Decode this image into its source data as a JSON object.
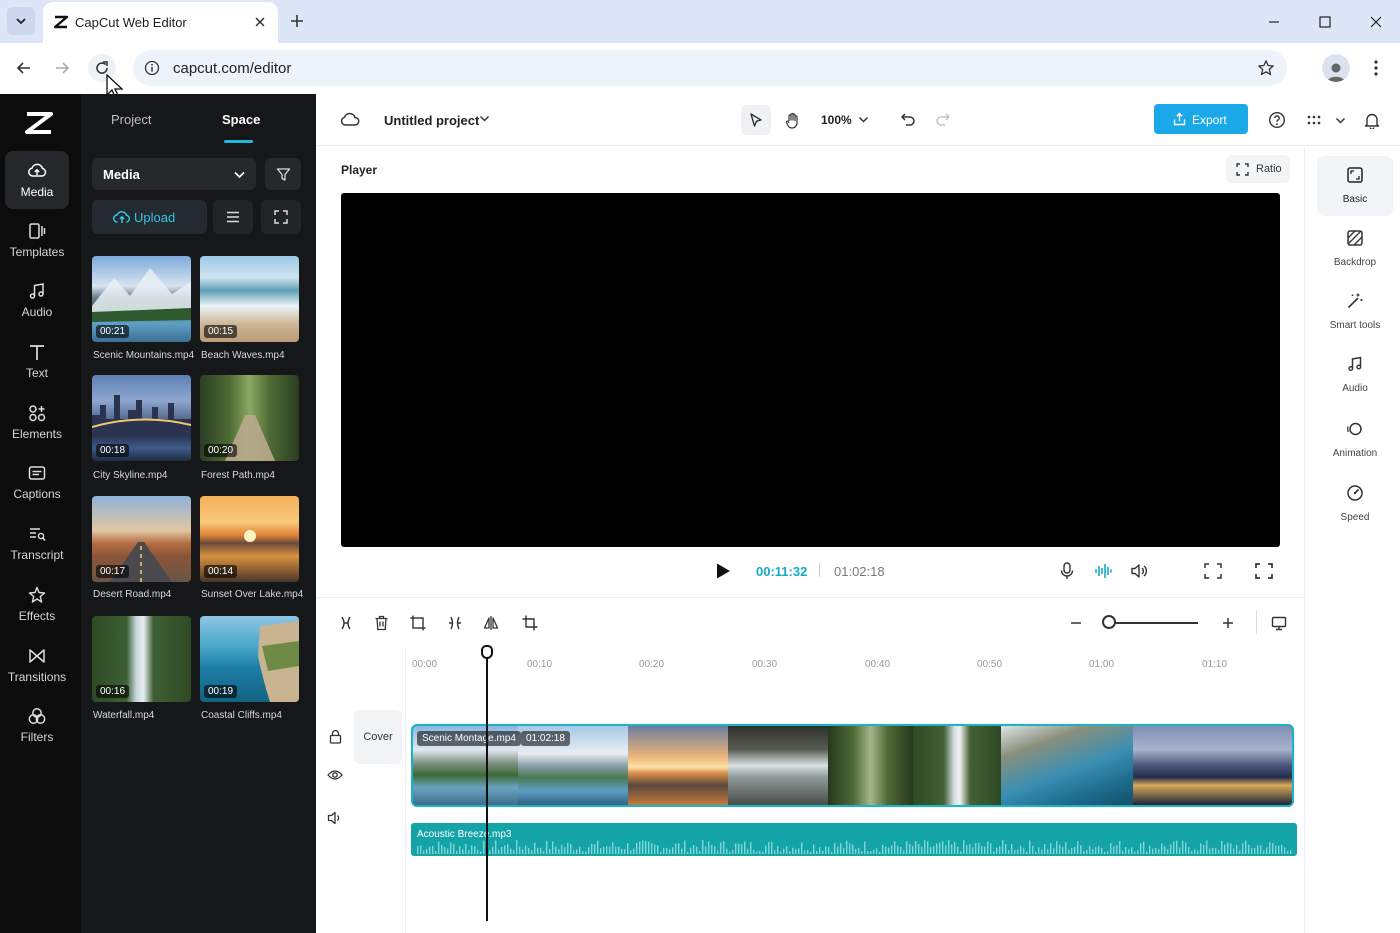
{
  "browser": {
    "tab_title": "CapCut Web Editor",
    "url": "capcut.com/editor"
  },
  "rail": {
    "items": [
      {
        "label": "Media",
        "icon": "cloud-media-icon",
        "active": true
      },
      {
        "label": "Templates",
        "icon": "templates-icon"
      },
      {
        "label": "Audio",
        "icon": "music-note-icon"
      },
      {
        "label": "Text",
        "icon": "text-t-icon"
      },
      {
        "label": "Elements",
        "icon": "elements-icon"
      },
      {
        "label": "Captions",
        "icon": "captions-icon"
      },
      {
        "label": "Transcript",
        "icon": "transcript-icon"
      },
      {
        "label": "Effects",
        "icon": "effects-star-icon"
      },
      {
        "label": "Transitions",
        "icon": "transitions-bowtie-icon"
      },
      {
        "label": "Filters",
        "icon": "filters-icon"
      }
    ]
  },
  "panel": {
    "tabs": [
      "Project",
      "Space"
    ],
    "active_tab": "Space",
    "media_select": "Media",
    "upload_label": "Upload",
    "media": [
      {
        "name": "Scenic Mountains.mp4",
        "duration": "00:21"
      },
      {
        "name": "Beach Waves.mp4",
        "duration": "00:15"
      },
      {
        "name": "City Skyline.mp4",
        "duration": "00:18"
      },
      {
        "name": "Forest Path.mp4",
        "duration": "00:20"
      },
      {
        "name": "Desert Road.mp4",
        "duration": "00:17"
      },
      {
        "name": "Sunset Over Lake.mp4",
        "duration": "00:14"
      },
      {
        "name": "Waterfall.mp4",
        "duration": "00:16"
      },
      {
        "name": "Coastal Cliffs.mp4",
        "duration": "00:19"
      }
    ]
  },
  "topbar": {
    "project_title": "Untitled project",
    "zoom": "100%",
    "export_label": "Export"
  },
  "player": {
    "label": "Player",
    "ratio_label": "Ratio",
    "current_time": "00:11:32",
    "total_time": "01:02:18"
  },
  "props": {
    "items": [
      {
        "label": "Basic",
        "active": true
      },
      {
        "label": "Backdrop"
      },
      {
        "label": "Smart tools"
      },
      {
        "label": "Audio"
      },
      {
        "label": "Animation"
      },
      {
        "label": "Speed"
      }
    ]
  },
  "timeline": {
    "cover_label": "Cover",
    "ticks": [
      "00:00",
      "00:10",
      "00:20",
      "00:30",
      "00:40",
      "00:50",
      "01:00",
      "01:10"
    ],
    "video_clip_name": "Scenic Montage.mp4",
    "video_clip_duration": "01:02:18",
    "audio_clip_name": "Acoustic Breeze.mp3"
  },
  "colors": {
    "accent": "#17a9c9",
    "export": "#1aa8e8",
    "track_border": "#19b4c6",
    "audio_track": "#14a4a8"
  }
}
